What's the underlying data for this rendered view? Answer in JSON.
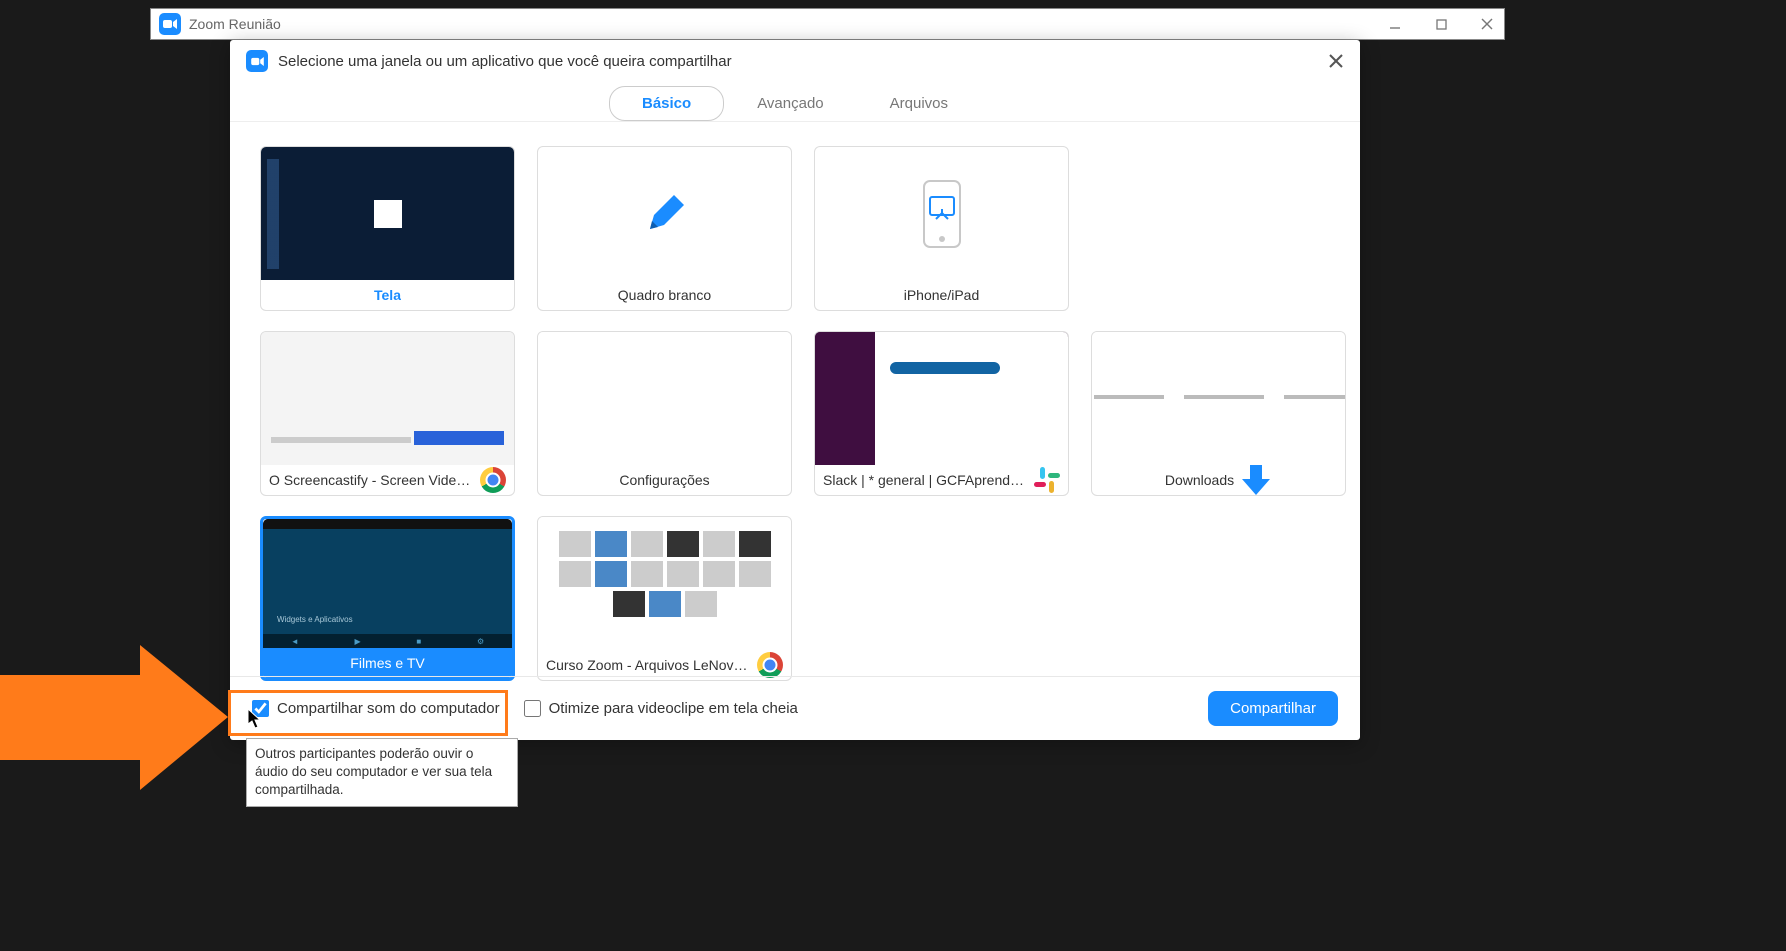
{
  "window": {
    "title": "Zoom Reunião"
  },
  "dialog": {
    "title": "Selecione uma janela ou um aplicativo que você queira compartilhar",
    "tabs": {
      "basic": "Básico",
      "advanced": "Avançado",
      "files": "Arquivos"
    },
    "items": {
      "screen": "Tela",
      "whiteboard": "Quadro branco",
      "iphone": "iPhone/iPad",
      "screencastify": "O Screencastify - Screen Video Re...",
      "config": "Configurações",
      "slack": "Slack | * general | GCFAprendeLibre",
      "downloads": "Downloads",
      "filmes": "Filmes e TV",
      "curso": "Curso Zoom - Arquivos LeNovo -..."
    },
    "footer": {
      "share_sound": "Compartilhar som do computador",
      "optimize": "Otimize para videoclipe em tela cheia",
      "share_btn": "Compartilhar"
    }
  },
  "tooltip": "Outros participantes poderão ouvir o áudio do seu computador e ver sua tela compartilhada.",
  "filmes_caption": "Widgets e Aplicativos"
}
